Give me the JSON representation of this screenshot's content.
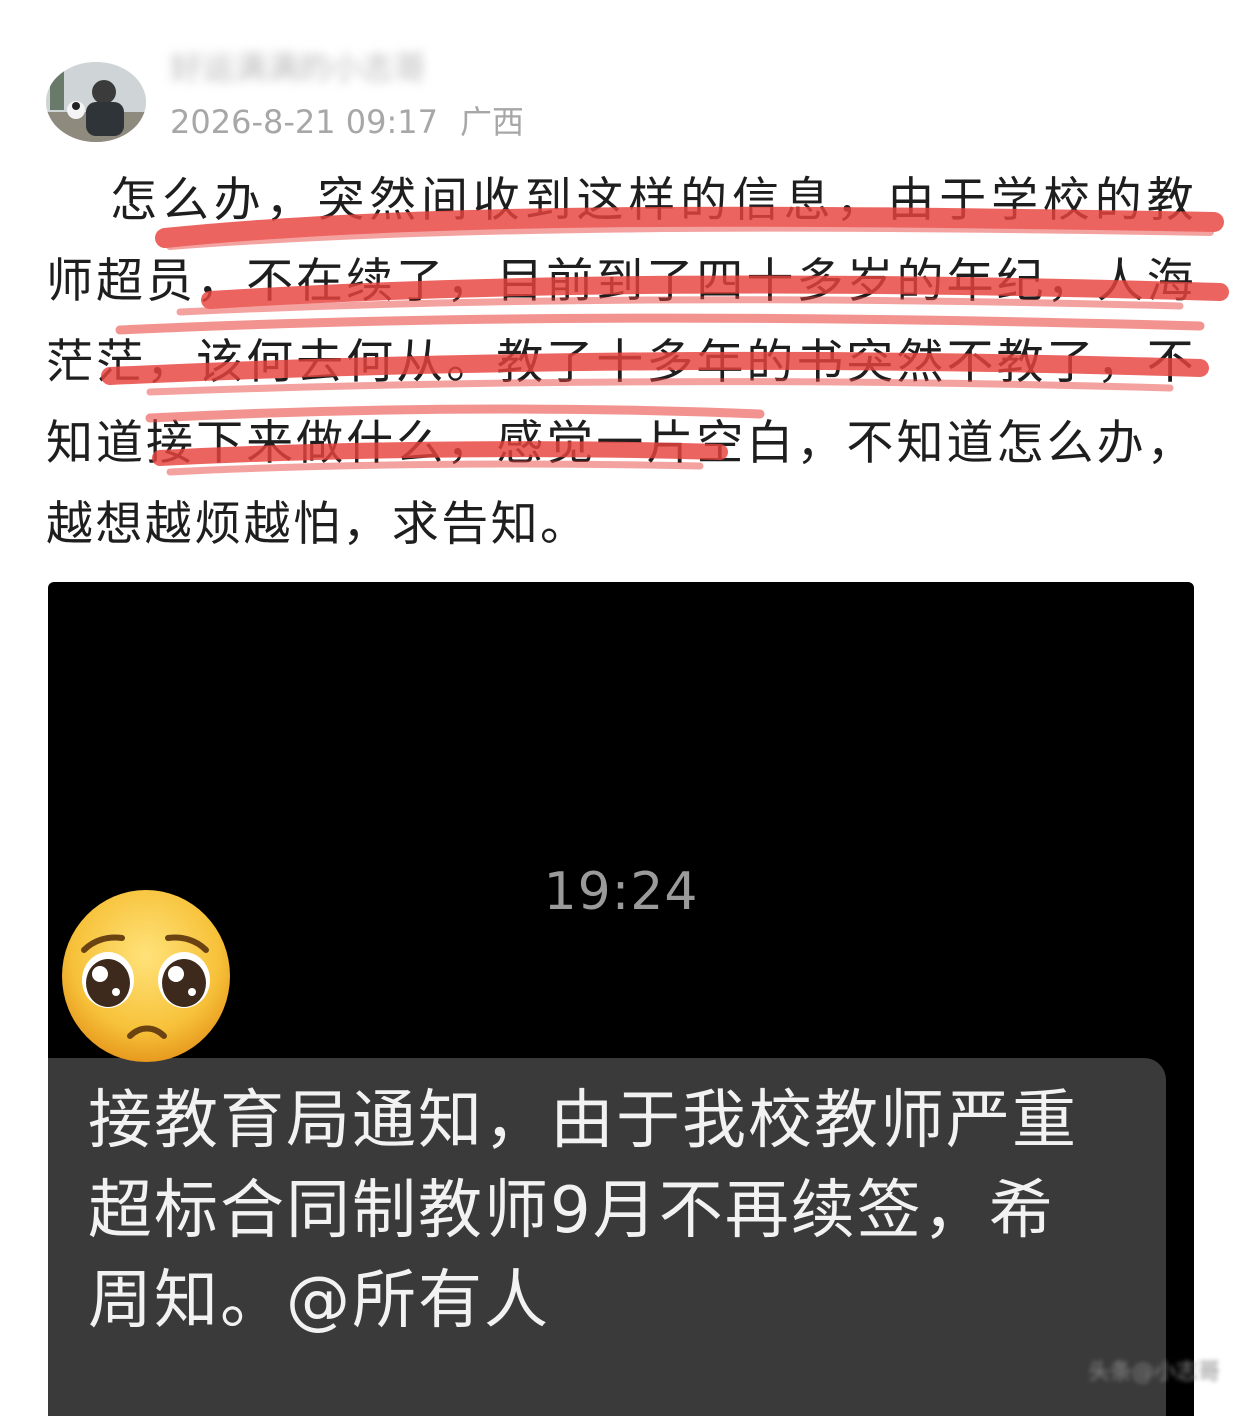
{
  "post": {
    "username": "好运满满的小志哥",
    "datetime": "2026-8-21 09:17",
    "location": "广西",
    "body": "怎么办，突然间收到这样的信息，由于学校的教师超员，不在续了，目前到了四十多岁的年纪，人海茫茫，该何去何从。教了十多年的书突然不教了，不知道接下来做什么，感觉一片空白，不知道怎么办，越想越烦越怕，求告知。"
  },
  "screenshot": {
    "clock": "19:24",
    "notification": "接教育局通知，由于我校教师严重超标合同制教师9月不再续签，希周知。@所有人"
  },
  "emoji": "pleading-face-icon",
  "watermark": "头条@小志哥",
  "colors": {
    "highlight": "#e8433d",
    "notification_bg": "#3a3a3a",
    "screen_bg": "#000000"
  }
}
